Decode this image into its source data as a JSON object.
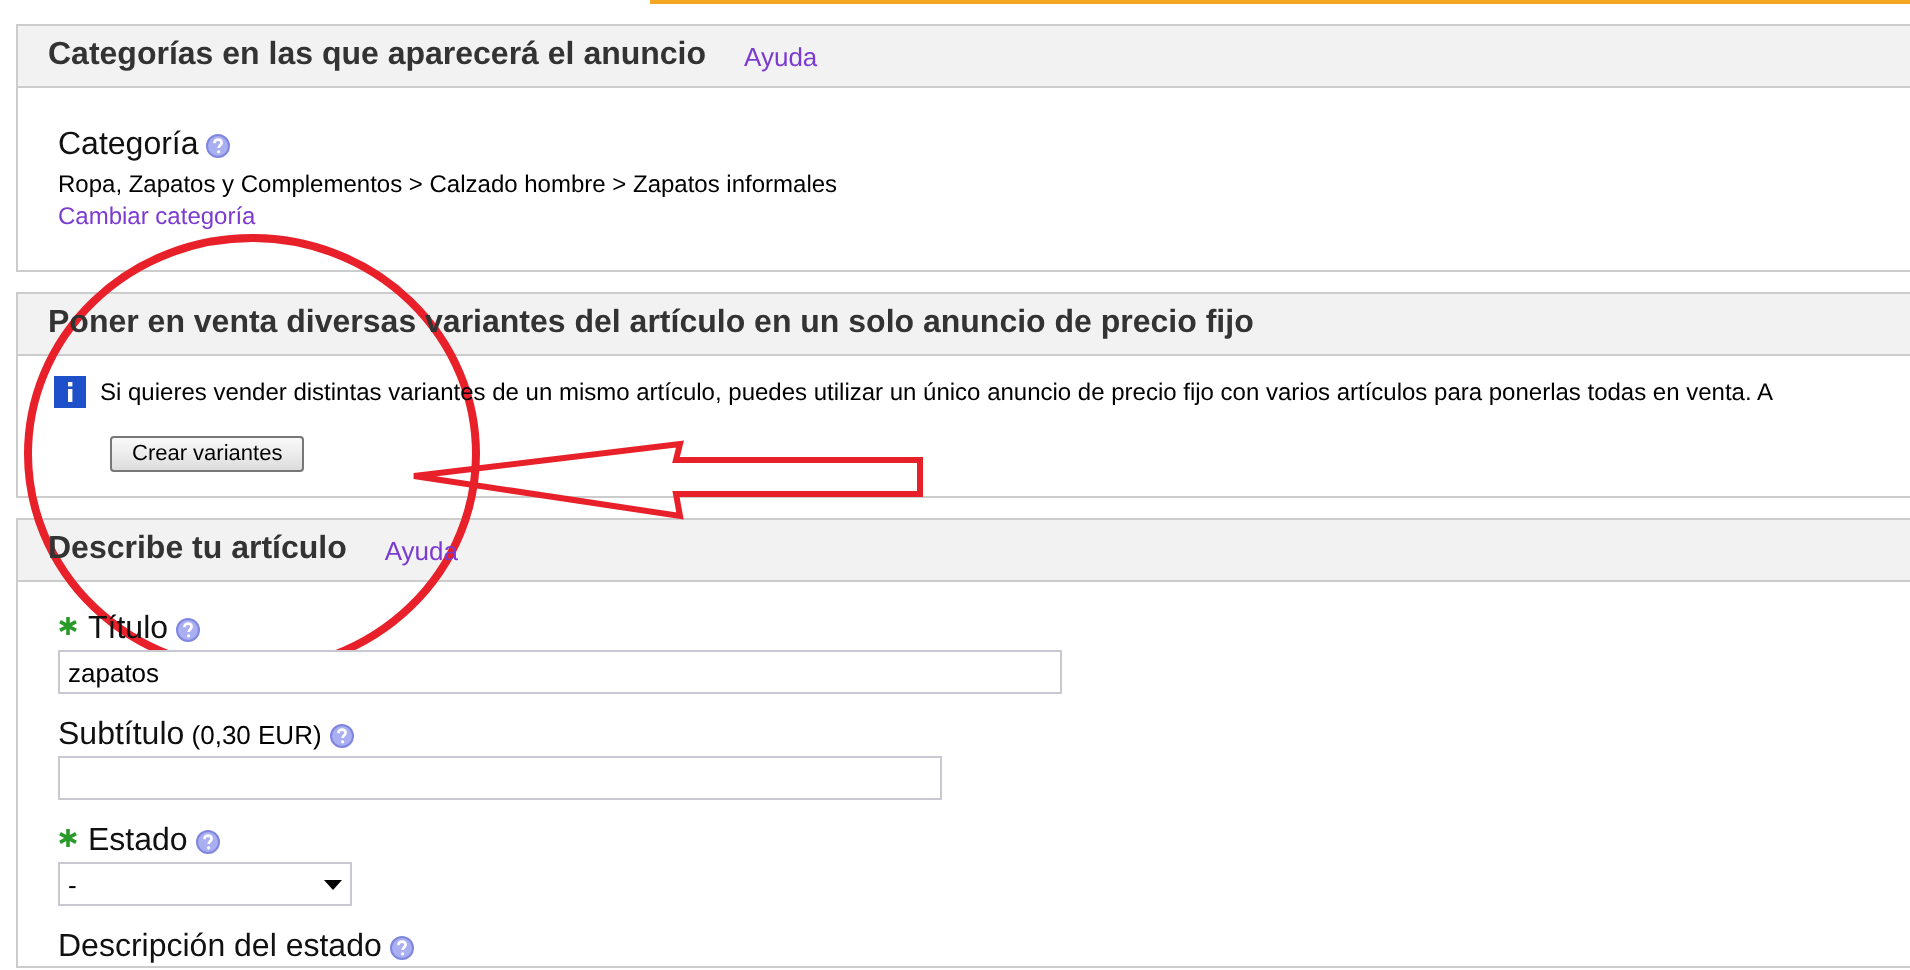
{
  "sections": [
    {
      "title": "Categorías en las que aparecerá el anuncio",
      "help_link": "Ayuda",
      "kind": "category",
      "label": "Categoría",
      "path": "Ropa, Zapatos y Complementos > Calzado hombre > Zapatos informales",
      "change_link": "Cambiar categoría"
    },
    {
      "title": "Poner en venta diversas variantes del artículo en un solo anuncio de precio fijo",
      "kind": "variants",
      "info": "Si quieres vender distintas variantes de un mismo artículo, puedes utilizar un único anuncio de precio fijo con varios artículos para ponerlas todas en venta. A",
      "button": "Crear variantes"
    },
    {
      "title": "Describe tu artículo",
      "help_link": "Ayuda",
      "kind": "fields",
      "fields": [
        {
          "kind": "text",
          "label": "Título",
          "required": true,
          "value": "zapatos"
        },
        {
          "kind": "text",
          "label": "Subtítulo",
          "note": "(0,30 EUR)",
          "required": false
        },
        {
          "kind": "select",
          "label": "Estado",
          "required": true,
          "value": "-"
        },
        {
          "kind": "label",
          "label": "Descripción del estado",
          "required": false
        }
      ]
    }
  ]
}
